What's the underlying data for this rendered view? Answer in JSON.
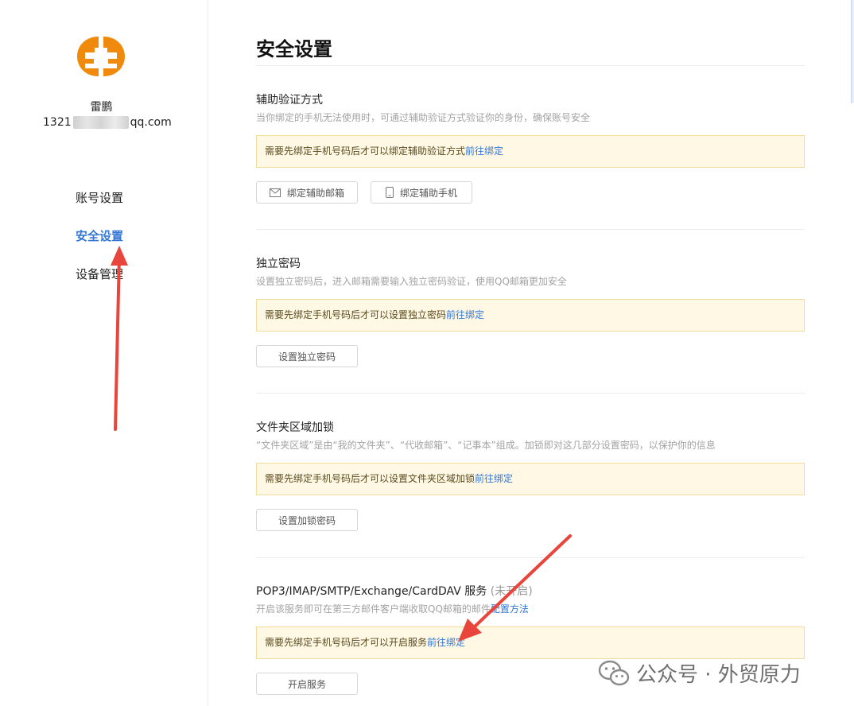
{
  "user": {
    "name": "雷鹏",
    "email_prefix": "1321",
    "email_suffix": "qq.com"
  },
  "nav": {
    "items": [
      {
        "label": "账号设置",
        "active": false
      },
      {
        "label": "安全设置",
        "active": true
      },
      {
        "label": "设备管理",
        "active": false
      }
    ]
  },
  "page": {
    "title": "安全设置"
  },
  "sections": {
    "aux_verify": {
      "title": "辅助验证方式",
      "desc": "当你绑定的手机无法使用时，可通过辅助验证方式验证你的身份，确保账号安全",
      "notice": "需要先绑定手机号码后才可以绑定辅助验证方式",
      "notice_link": "前往绑定",
      "bind_email_label": "绑定辅助邮箱",
      "bind_phone_label": "绑定辅助手机"
    },
    "indep_password": {
      "title": "独立密码",
      "desc": "设置独立密码后，进入邮箱需要输入独立密码验证，使用QQ邮箱更加安全",
      "notice": "需要先绑定手机号码后才可以设置独立密码",
      "notice_link": "前往绑定",
      "button_label": "设置独立密码"
    },
    "folder_lock": {
      "title": "文件夹区域加锁",
      "desc": "“文件夹区域”是由“我的文件夹”、“代收邮箱”、“记事本”组成。加锁即对这几部分设置密码，以保护你的信息",
      "notice": "需要先绑定手机号码后才可以设置文件夹区域加锁",
      "notice_link": "前往绑定",
      "button_label": "设置加锁密码"
    },
    "pop3": {
      "title": "POP3/IMAP/SMTP/Exchange/CardDAV 服务",
      "status": "(未开启)",
      "desc": "开启该服务即可在第三方邮件客户端收取QQ邮箱的邮件",
      "desc_link": "配置方法",
      "notice": "需要先绑定手机号码后才可以开启服务",
      "notice_link": "前往绑定",
      "button_label": "开启服务"
    }
  },
  "watermark": {
    "text": "公众号 · 外贸原力"
  },
  "colors": {
    "accent": "#3377d6",
    "notice_bg": "#fff8e5",
    "notice_border": "#f3db9b",
    "arrow": "#e8453c",
    "avatar": "#f08a0c"
  }
}
